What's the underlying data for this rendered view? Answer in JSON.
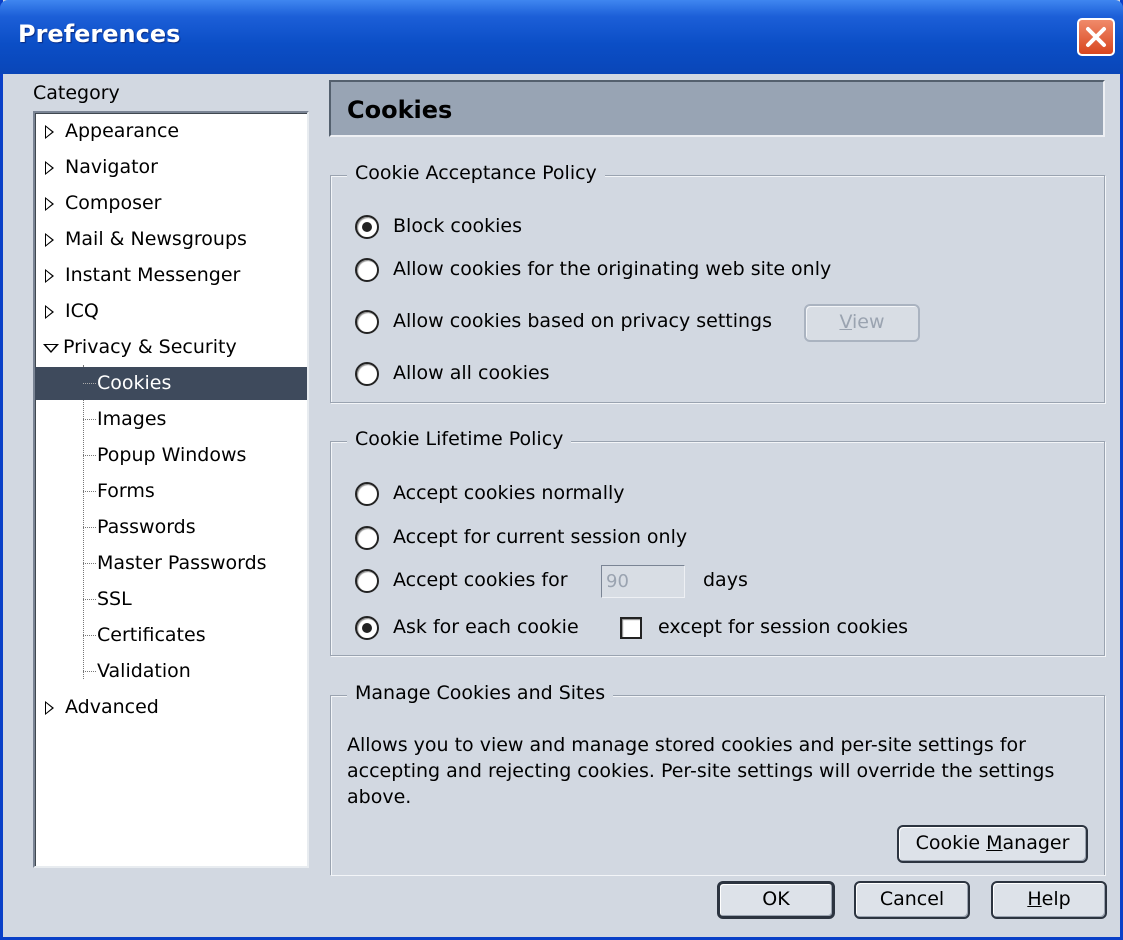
{
  "window": {
    "title": "Preferences"
  },
  "sidebar": {
    "label": "Category",
    "items": [
      {
        "label": "Appearance"
      },
      {
        "label": "Navigator"
      },
      {
        "label": "Composer"
      },
      {
        "label": "Mail & Newsgroups"
      },
      {
        "label": "Instant Messenger"
      },
      {
        "label": "ICQ"
      },
      {
        "label": "Privacy & Security"
      },
      {
        "label": "Cookies"
      },
      {
        "label": "Images"
      },
      {
        "label": "Popup Windows"
      },
      {
        "label": "Forms"
      },
      {
        "label": "Passwords"
      },
      {
        "label": "Master Passwords"
      },
      {
        "label": "SSL"
      },
      {
        "label": "Certificates"
      },
      {
        "label": "Validation"
      },
      {
        "label": "Advanced"
      }
    ],
    "selected": "Cookies"
  },
  "panel": {
    "title": "Cookies"
  },
  "acceptance": {
    "title": "Cookie Acceptance Policy",
    "options": [
      {
        "label": "Block cookies",
        "checked": true
      },
      {
        "label": "Allow cookies for the originating web site only",
        "checked": false
      },
      {
        "label": "Allow cookies based on privacy settings",
        "checked": false
      },
      {
        "label": "Allow all cookies",
        "checked": false
      }
    ],
    "view_button_pre": "",
    "view_button_mnemonic": "V",
    "view_button_post": "iew"
  },
  "lifetime": {
    "title": "Cookie Lifetime Policy",
    "options": [
      {
        "label": "Accept cookies normally",
        "checked": false
      },
      {
        "label": "Accept for current session only",
        "checked": false
      },
      {
        "label": "Accept cookies for",
        "checked": false
      },
      {
        "label": "Ask for each cookie",
        "checked": true
      }
    ],
    "days_value": "90",
    "days_label": "days",
    "except_label": "except for session cookies",
    "except_checked": false
  },
  "manage": {
    "title": "Manage Cookies and Sites",
    "description": "Allows you to view and manage stored cookies and per-site settings for accepting and rejecting cookies. Per-site settings will override the settings above.",
    "button_pre": "Cookie ",
    "button_mnemonic": "M",
    "button_post": "anager"
  },
  "footer": {
    "ok": "OK",
    "cancel": "Cancel",
    "help_mnemonic": "H",
    "help_post": "elp"
  },
  "colors": {
    "titlebar": "#0b4ec6",
    "selection": "#3e4a5c",
    "dialog_bg": "#d2d8e1"
  }
}
